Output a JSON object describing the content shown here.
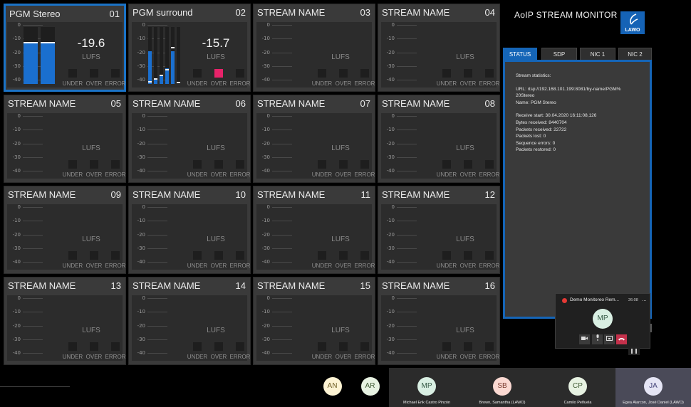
{
  "app": {
    "title": "AoIP STREAM MONITOR",
    "logo_text": "LAWO",
    "colors": {
      "accent": "#1565b7",
      "meter_fill": "#1a6fcf",
      "alarm": "#e8236a",
      "tile_bg": "#3a3a3a"
    }
  },
  "meter_scale": [
    "0",
    "-10",
    "-20",
    "-30",
    "-40"
  ],
  "indicator_labels": {
    "under": "UNDER",
    "over": "OVER",
    "error": "ERROR"
  },
  "tiles": [
    {
      "name": "PGM Stereo",
      "num": "01",
      "lufs_value": "-19.6",
      "lufs_label": "LUFS",
      "selected": true,
      "meters": [
        {
          "level": 0.73,
          "peak": 0.71
        },
        {
          "level": 0.73,
          "peak": 0.71
        }
      ],
      "over_active": false
    },
    {
      "name": "PGM surround",
      "num": "02",
      "lufs_value": "-15.7",
      "lufs_label": "LUFS",
      "selected": false,
      "meters": [
        {
          "level": 0.57,
          "peak": 0.03
        },
        {
          "level": 0.07,
          "peak": 0.07
        },
        {
          "level": 0.15,
          "peak": 0.14
        },
        {
          "level": 0.27,
          "peak": 0.24
        },
        {
          "level": 0.58,
          "peak": 0.62
        },
        {
          "level": 0.0,
          "peak": 0.01
        }
      ],
      "over_active": true
    },
    {
      "name": "STREAM NAME",
      "num": "03",
      "lufs_label": "LUFS"
    },
    {
      "name": "STREAM NAME",
      "num": "04",
      "lufs_label": "LUFS"
    },
    {
      "name": "STREAM NAME",
      "num": "05",
      "lufs_label": "LUFS"
    },
    {
      "name": "STREAM NAME",
      "num": "06",
      "lufs_label": "LUFS"
    },
    {
      "name": "STREAM NAME",
      "num": "07",
      "lufs_label": "LUFS"
    },
    {
      "name": "STREAM NAME",
      "num": "08",
      "lufs_label": "LUFS"
    },
    {
      "name": "STREAM NAME",
      "num": "09",
      "lufs_label": "LUFS"
    },
    {
      "name": "STREAM NAME",
      "num": "10",
      "lufs_label": "LUFS"
    },
    {
      "name": "STREAM NAME",
      "num": "11",
      "lufs_label": "LUFS"
    },
    {
      "name": "STREAM NAME",
      "num": "12",
      "lufs_label": "LUFS"
    },
    {
      "name": "STREAM NAME",
      "num": "13",
      "lufs_label": "LUFS"
    },
    {
      "name": "STREAM NAME",
      "num": "14",
      "lufs_label": "LUFS"
    },
    {
      "name": "STREAM NAME",
      "num": "15",
      "lufs_label": "LUFS"
    },
    {
      "name": "STREAM NAME",
      "num": "16",
      "lufs_label": "LUFS"
    }
  ],
  "tabs": [
    {
      "label": "STATUS",
      "active": true
    },
    {
      "label": "SDP",
      "active": false
    },
    {
      "label": "NIC 1",
      "active": false
    },
    {
      "label": "NIC 2",
      "active": false
    }
  ],
  "status": {
    "heading": "Stream statistics:",
    "url_line1": "URL: rtsp://192.168.101.199:8081/by-name/PGM%",
    "url_line2": "20Stereo",
    "name": "Name: PGM Stereo",
    "receive_start": "Receive start: 30.04.2020 16:11:08,126",
    "bytes_received": "Bytes received: 8440704",
    "packets_received": "Packets received: 22722",
    "packets_lost": "Packets lost: 0",
    "sequence_errors": "Sequence errors: 0",
    "packets_restored": "Packets restored: 0"
  },
  "call": {
    "title": "Demo Monitoreo Rem...",
    "time": "26:08",
    "more": "...",
    "avatar": "MP",
    "buttons": [
      "camera-icon",
      "mic-icon",
      "share-icon",
      "hangup-icon"
    ]
  },
  "participants": [
    {
      "initials": "AN",
      "name": "",
      "bg": "#fdf3d3",
      "fg": "#6b5a21"
    },
    {
      "initials": "AR",
      "name": "",
      "bg": "#e7f2e2",
      "fg": "#3e5a33"
    },
    {
      "initials": "MP",
      "name": "Michael Erik Castro Pinzón",
      "bg": "#d9efe3",
      "fg": "#355a46"
    },
    {
      "initials": "SB",
      "name": "Brown, Samantha (LAWO)",
      "bg": "#fbd9d2",
      "fg": "#7a3a2d"
    },
    {
      "initials": "CP",
      "name": "Camilo Peñuela",
      "bg": "#e7f2e2",
      "fg": "#3e5a33"
    },
    {
      "initials": "JA",
      "name": "Egea Alarcon, José Daniel (LAWO)",
      "bg": "#e5e5f5",
      "fg": "#44447a"
    }
  ]
}
